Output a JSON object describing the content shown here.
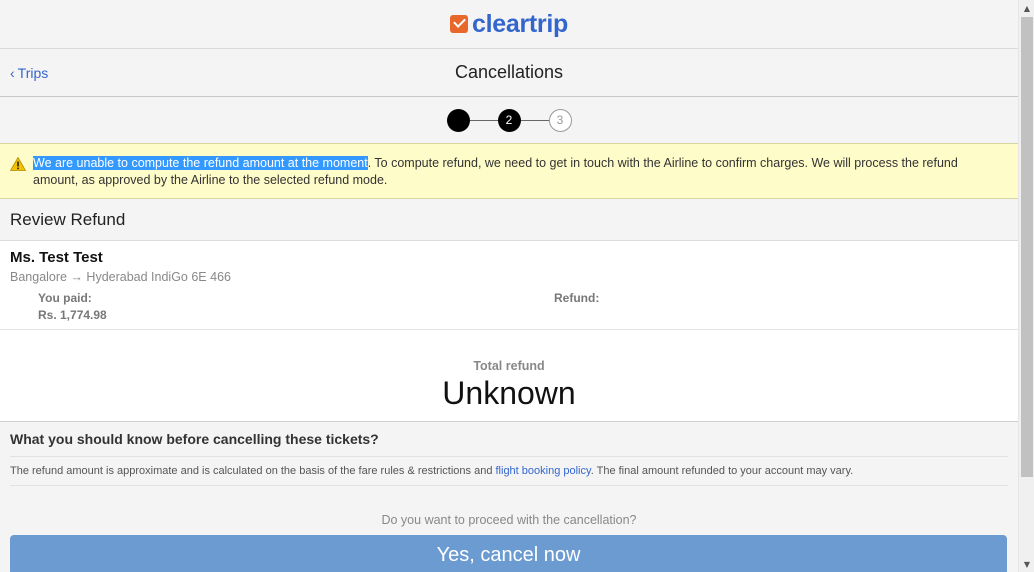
{
  "brand": {
    "logo_text": "cleartrip",
    "logo_color": "#e8672a",
    "text_color": "#3366cc"
  },
  "nav": {
    "back_label": "Trips",
    "back_icon": "chevron-left-icon",
    "title": "Cancellations"
  },
  "stepper": {
    "steps": [
      "",
      "2",
      "3"
    ],
    "current": 2
  },
  "warning": {
    "icon": "warning-icon",
    "highlighted_text": "We are unable to compute the refund amount at the moment",
    "rest_text": ". To compute refund, we need to get in touch with the Airline to confirm charges. We will process the refund amount, as approved by the Airline to the selected refund mode."
  },
  "review": {
    "heading": "Review Refund",
    "passenger": {
      "name": "Ms. Test Test",
      "route": "Bangalore → Hyderabad IndiGo 6E 466",
      "paid_label": "You paid:",
      "paid_value": "Rs. 1,774.98",
      "refund_label": "Refund:"
    },
    "total_label": "Total refund",
    "total_value": "Unknown"
  },
  "info": {
    "title": "What you should know before cancelling these tickets?",
    "text_before": "The refund amount is approximate and is calculated on the basis of the fare rules & restrictions and ",
    "link_text": "flight booking policy",
    "text_after": ". The final amount refunded to your account may vary."
  },
  "confirm": {
    "question": "Do you want to proceed with the cancellation?",
    "button_label": "Yes, cancel now",
    "button_color": "#6b9bd1"
  }
}
